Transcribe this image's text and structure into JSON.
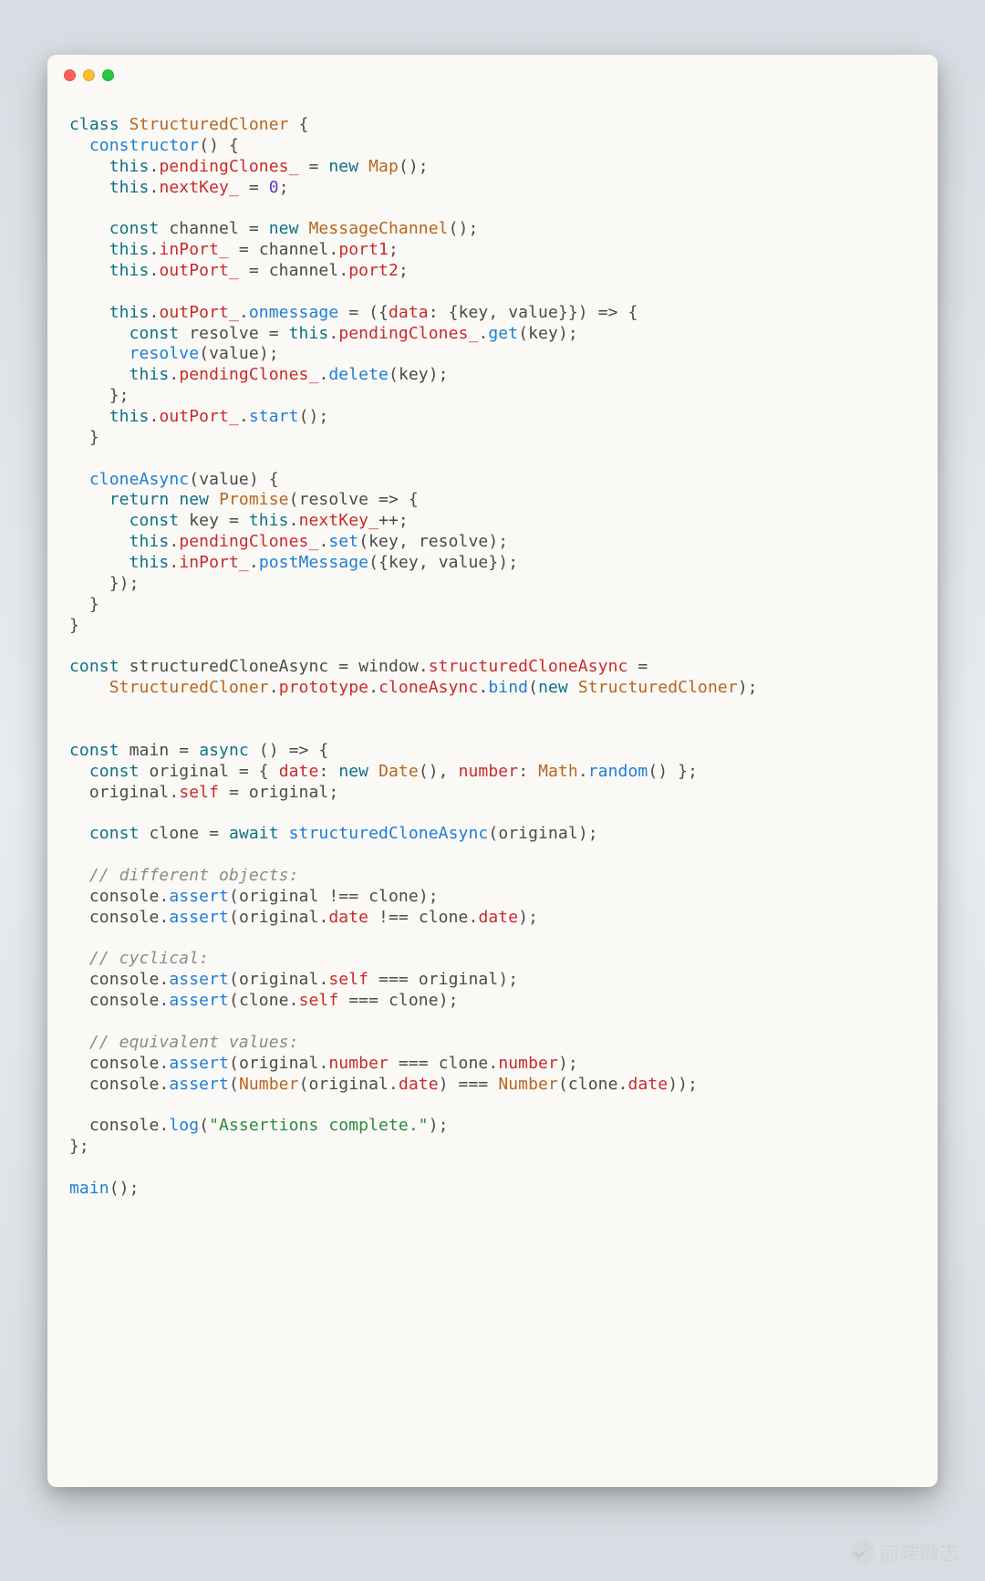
{
  "watermark": {
    "text": "前端微志"
  },
  "code": {
    "language": "javascript",
    "tokens": [
      {
        "t": "kw",
        "s": "class"
      },
      {
        "t": "punc",
        "s": " "
      },
      {
        "t": "cls",
        "s": "StructuredCloner"
      },
      {
        "t": "punc",
        "s": " {"
      },
      {
        "t": "nl"
      },
      {
        "t": "punc",
        "s": "  "
      },
      {
        "t": "fn",
        "s": "constructor"
      },
      {
        "t": "punc",
        "s": "() {"
      },
      {
        "t": "nl"
      },
      {
        "t": "punc",
        "s": "    "
      },
      {
        "t": "kw",
        "s": "this"
      },
      {
        "t": "punc",
        "s": "."
      },
      {
        "t": "prop",
        "s": "pendingClones_"
      },
      {
        "t": "punc",
        "s": " = "
      },
      {
        "t": "kw",
        "s": "new"
      },
      {
        "t": "punc",
        "s": " "
      },
      {
        "t": "cls",
        "s": "Map"
      },
      {
        "t": "punc",
        "s": "();"
      },
      {
        "t": "nl"
      },
      {
        "t": "punc",
        "s": "    "
      },
      {
        "t": "kw",
        "s": "this"
      },
      {
        "t": "punc",
        "s": "."
      },
      {
        "t": "prop",
        "s": "nextKey_"
      },
      {
        "t": "punc",
        "s": " = "
      },
      {
        "t": "num",
        "s": "0"
      },
      {
        "t": "punc",
        "s": ";"
      },
      {
        "t": "nl"
      },
      {
        "t": "nl"
      },
      {
        "t": "punc",
        "s": "    "
      },
      {
        "t": "kw",
        "s": "const"
      },
      {
        "t": "punc",
        "s": " "
      },
      {
        "t": "id",
        "s": "channel"
      },
      {
        "t": "punc",
        "s": " = "
      },
      {
        "t": "kw",
        "s": "new"
      },
      {
        "t": "punc",
        "s": " "
      },
      {
        "t": "cls",
        "s": "MessageChannel"
      },
      {
        "t": "punc",
        "s": "();"
      },
      {
        "t": "nl"
      },
      {
        "t": "punc",
        "s": "    "
      },
      {
        "t": "kw",
        "s": "this"
      },
      {
        "t": "punc",
        "s": "."
      },
      {
        "t": "prop",
        "s": "inPort_"
      },
      {
        "t": "punc",
        "s": " = "
      },
      {
        "t": "id",
        "s": "channel"
      },
      {
        "t": "punc",
        "s": "."
      },
      {
        "t": "prop",
        "s": "port1"
      },
      {
        "t": "punc",
        "s": ";"
      },
      {
        "t": "nl"
      },
      {
        "t": "punc",
        "s": "    "
      },
      {
        "t": "kw",
        "s": "this"
      },
      {
        "t": "punc",
        "s": "."
      },
      {
        "t": "prop",
        "s": "outPort_"
      },
      {
        "t": "punc",
        "s": " = "
      },
      {
        "t": "id",
        "s": "channel"
      },
      {
        "t": "punc",
        "s": "."
      },
      {
        "t": "prop",
        "s": "port2"
      },
      {
        "t": "punc",
        "s": ";"
      },
      {
        "t": "nl"
      },
      {
        "t": "nl"
      },
      {
        "t": "punc",
        "s": "    "
      },
      {
        "t": "kw",
        "s": "this"
      },
      {
        "t": "punc",
        "s": "."
      },
      {
        "t": "prop",
        "s": "outPort_"
      },
      {
        "t": "punc",
        "s": "."
      },
      {
        "t": "fn",
        "s": "onmessage"
      },
      {
        "t": "punc",
        "s": " = ({"
      },
      {
        "t": "prop",
        "s": "data"
      },
      {
        "t": "punc",
        "s": ": {"
      },
      {
        "t": "id",
        "s": "key"
      },
      {
        "t": "punc",
        "s": ", "
      },
      {
        "t": "id",
        "s": "value"
      },
      {
        "t": "punc",
        "s": "}}) => {"
      },
      {
        "t": "nl"
      },
      {
        "t": "punc",
        "s": "      "
      },
      {
        "t": "kw",
        "s": "const"
      },
      {
        "t": "punc",
        "s": " "
      },
      {
        "t": "id",
        "s": "resolve"
      },
      {
        "t": "punc",
        "s": " = "
      },
      {
        "t": "kw",
        "s": "this"
      },
      {
        "t": "punc",
        "s": "."
      },
      {
        "t": "prop",
        "s": "pendingClones_"
      },
      {
        "t": "punc",
        "s": "."
      },
      {
        "t": "fn",
        "s": "get"
      },
      {
        "t": "punc",
        "s": "("
      },
      {
        "t": "id",
        "s": "key"
      },
      {
        "t": "punc",
        "s": ");"
      },
      {
        "t": "nl"
      },
      {
        "t": "punc",
        "s": "      "
      },
      {
        "t": "fn",
        "s": "resolve"
      },
      {
        "t": "punc",
        "s": "("
      },
      {
        "t": "id",
        "s": "value"
      },
      {
        "t": "punc",
        "s": ");"
      },
      {
        "t": "nl"
      },
      {
        "t": "punc",
        "s": "      "
      },
      {
        "t": "kw",
        "s": "this"
      },
      {
        "t": "punc",
        "s": "."
      },
      {
        "t": "prop",
        "s": "pendingClones_"
      },
      {
        "t": "punc",
        "s": "."
      },
      {
        "t": "fn",
        "s": "delete"
      },
      {
        "t": "punc",
        "s": "("
      },
      {
        "t": "id",
        "s": "key"
      },
      {
        "t": "punc",
        "s": ");"
      },
      {
        "t": "nl"
      },
      {
        "t": "punc",
        "s": "    };"
      },
      {
        "t": "nl"
      },
      {
        "t": "punc",
        "s": "    "
      },
      {
        "t": "kw",
        "s": "this"
      },
      {
        "t": "punc",
        "s": "."
      },
      {
        "t": "prop",
        "s": "outPort_"
      },
      {
        "t": "punc",
        "s": "."
      },
      {
        "t": "fn",
        "s": "start"
      },
      {
        "t": "punc",
        "s": "();"
      },
      {
        "t": "nl"
      },
      {
        "t": "punc",
        "s": "  }"
      },
      {
        "t": "nl"
      },
      {
        "t": "nl"
      },
      {
        "t": "punc",
        "s": "  "
      },
      {
        "t": "fn",
        "s": "cloneAsync"
      },
      {
        "t": "punc",
        "s": "("
      },
      {
        "t": "id",
        "s": "value"
      },
      {
        "t": "punc",
        "s": ") {"
      },
      {
        "t": "nl"
      },
      {
        "t": "punc",
        "s": "    "
      },
      {
        "t": "kw",
        "s": "return"
      },
      {
        "t": "punc",
        "s": " "
      },
      {
        "t": "kw",
        "s": "new"
      },
      {
        "t": "punc",
        "s": " "
      },
      {
        "t": "cls",
        "s": "Promise"
      },
      {
        "t": "punc",
        "s": "("
      },
      {
        "t": "id",
        "s": "resolve"
      },
      {
        "t": "punc",
        "s": " => {"
      },
      {
        "t": "nl"
      },
      {
        "t": "punc",
        "s": "      "
      },
      {
        "t": "kw",
        "s": "const"
      },
      {
        "t": "punc",
        "s": " "
      },
      {
        "t": "id",
        "s": "key"
      },
      {
        "t": "punc",
        "s": " = "
      },
      {
        "t": "kw",
        "s": "this"
      },
      {
        "t": "punc",
        "s": "."
      },
      {
        "t": "prop",
        "s": "nextKey_"
      },
      {
        "t": "punc",
        "s": "++;"
      },
      {
        "t": "nl"
      },
      {
        "t": "punc",
        "s": "      "
      },
      {
        "t": "kw",
        "s": "this"
      },
      {
        "t": "punc",
        "s": "."
      },
      {
        "t": "prop",
        "s": "pendingClones_"
      },
      {
        "t": "punc",
        "s": "."
      },
      {
        "t": "fn",
        "s": "set"
      },
      {
        "t": "punc",
        "s": "("
      },
      {
        "t": "id",
        "s": "key"
      },
      {
        "t": "punc",
        "s": ", "
      },
      {
        "t": "id",
        "s": "resolve"
      },
      {
        "t": "punc",
        "s": ");"
      },
      {
        "t": "nl"
      },
      {
        "t": "punc",
        "s": "      "
      },
      {
        "t": "kw",
        "s": "this"
      },
      {
        "t": "punc",
        "s": "."
      },
      {
        "t": "prop",
        "s": "inPort_"
      },
      {
        "t": "punc",
        "s": "."
      },
      {
        "t": "fn",
        "s": "postMessage"
      },
      {
        "t": "punc",
        "s": "({"
      },
      {
        "t": "id",
        "s": "key"
      },
      {
        "t": "punc",
        "s": ", "
      },
      {
        "t": "id",
        "s": "value"
      },
      {
        "t": "punc",
        "s": "});"
      },
      {
        "t": "nl"
      },
      {
        "t": "punc",
        "s": "    });"
      },
      {
        "t": "nl"
      },
      {
        "t": "punc",
        "s": "  }"
      },
      {
        "t": "nl"
      },
      {
        "t": "punc",
        "s": "}"
      },
      {
        "t": "nl"
      },
      {
        "t": "nl"
      },
      {
        "t": "kw",
        "s": "const"
      },
      {
        "t": "punc",
        "s": " "
      },
      {
        "t": "id",
        "s": "structuredCloneAsync"
      },
      {
        "t": "punc",
        "s": " = "
      },
      {
        "t": "id",
        "s": "window"
      },
      {
        "t": "punc",
        "s": "."
      },
      {
        "t": "prop",
        "s": "structuredCloneAsync"
      },
      {
        "t": "punc",
        "s": " ="
      },
      {
        "t": "nl"
      },
      {
        "t": "punc",
        "s": "    "
      },
      {
        "t": "cls",
        "s": "StructuredCloner"
      },
      {
        "t": "punc",
        "s": "."
      },
      {
        "t": "prop",
        "s": "prototype"
      },
      {
        "t": "punc",
        "s": "."
      },
      {
        "t": "prop",
        "s": "cloneAsync"
      },
      {
        "t": "punc",
        "s": "."
      },
      {
        "t": "fn",
        "s": "bind"
      },
      {
        "t": "punc",
        "s": "("
      },
      {
        "t": "kw",
        "s": "new"
      },
      {
        "t": "punc",
        "s": " "
      },
      {
        "t": "cls",
        "s": "StructuredCloner"
      },
      {
        "t": "punc",
        "s": ");"
      },
      {
        "t": "nl"
      },
      {
        "t": "nl"
      },
      {
        "t": "nl"
      },
      {
        "t": "kw",
        "s": "const"
      },
      {
        "t": "punc",
        "s": " "
      },
      {
        "t": "id",
        "s": "main"
      },
      {
        "t": "punc",
        "s": " = "
      },
      {
        "t": "kw",
        "s": "async"
      },
      {
        "t": "punc",
        "s": " () => {"
      },
      {
        "t": "nl"
      },
      {
        "t": "punc",
        "s": "  "
      },
      {
        "t": "kw",
        "s": "const"
      },
      {
        "t": "punc",
        "s": " "
      },
      {
        "t": "id",
        "s": "original"
      },
      {
        "t": "punc",
        "s": " = { "
      },
      {
        "t": "prop",
        "s": "date"
      },
      {
        "t": "punc",
        "s": ": "
      },
      {
        "t": "kw",
        "s": "new"
      },
      {
        "t": "punc",
        "s": " "
      },
      {
        "t": "cls",
        "s": "Date"
      },
      {
        "t": "punc",
        "s": "(), "
      },
      {
        "t": "prop",
        "s": "number"
      },
      {
        "t": "punc",
        "s": ": "
      },
      {
        "t": "cls",
        "s": "Math"
      },
      {
        "t": "punc",
        "s": "."
      },
      {
        "t": "fn",
        "s": "random"
      },
      {
        "t": "punc",
        "s": "() };"
      },
      {
        "t": "nl"
      },
      {
        "t": "punc",
        "s": "  "
      },
      {
        "t": "id",
        "s": "original"
      },
      {
        "t": "punc",
        "s": "."
      },
      {
        "t": "prop",
        "s": "self"
      },
      {
        "t": "punc",
        "s": " = "
      },
      {
        "t": "id",
        "s": "original"
      },
      {
        "t": "punc",
        "s": ";"
      },
      {
        "t": "nl"
      },
      {
        "t": "nl"
      },
      {
        "t": "punc",
        "s": "  "
      },
      {
        "t": "kw",
        "s": "const"
      },
      {
        "t": "punc",
        "s": " "
      },
      {
        "t": "id",
        "s": "clone"
      },
      {
        "t": "punc",
        "s": " = "
      },
      {
        "t": "kw",
        "s": "await"
      },
      {
        "t": "punc",
        "s": " "
      },
      {
        "t": "fn",
        "s": "structuredCloneAsync"
      },
      {
        "t": "punc",
        "s": "("
      },
      {
        "t": "id",
        "s": "original"
      },
      {
        "t": "punc",
        "s": ");"
      },
      {
        "t": "nl"
      },
      {
        "t": "nl"
      },
      {
        "t": "punc",
        "s": "  "
      },
      {
        "t": "cmt",
        "s": "// different objects:"
      },
      {
        "t": "nl"
      },
      {
        "t": "punc",
        "s": "  "
      },
      {
        "t": "id",
        "s": "console"
      },
      {
        "t": "punc",
        "s": "."
      },
      {
        "t": "fn",
        "s": "assert"
      },
      {
        "t": "punc",
        "s": "("
      },
      {
        "t": "id",
        "s": "original"
      },
      {
        "t": "punc",
        "s": " !== "
      },
      {
        "t": "id",
        "s": "clone"
      },
      {
        "t": "punc",
        "s": ");"
      },
      {
        "t": "nl"
      },
      {
        "t": "punc",
        "s": "  "
      },
      {
        "t": "id",
        "s": "console"
      },
      {
        "t": "punc",
        "s": "."
      },
      {
        "t": "fn",
        "s": "assert"
      },
      {
        "t": "punc",
        "s": "("
      },
      {
        "t": "id",
        "s": "original"
      },
      {
        "t": "punc",
        "s": "."
      },
      {
        "t": "prop",
        "s": "date"
      },
      {
        "t": "punc",
        "s": " !== "
      },
      {
        "t": "id",
        "s": "clone"
      },
      {
        "t": "punc",
        "s": "."
      },
      {
        "t": "prop",
        "s": "date"
      },
      {
        "t": "punc",
        "s": ");"
      },
      {
        "t": "nl"
      },
      {
        "t": "nl"
      },
      {
        "t": "punc",
        "s": "  "
      },
      {
        "t": "cmt",
        "s": "// cyclical:"
      },
      {
        "t": "nl"
      },
      {
        "t": "punc",
        "s": "  "
      },
      {
        "t": "id",
        "s": "console"
      },
      {
        "t": "punc",
        "s": "."
      },
      {
        "t": "fn",
        "s": "assert"
      },
      {
        "t": "punc",
        "s": "("
      },
      {
        "t": "id",
        "s": "original"
      },
      {
        "t": "punc",
        "s": "."
      },
      {
        "t": "prop",
        "s": "self"
      },
      {
        "t": "punc",
        "s": " === "
      },
      {
        "t": "id",
        "s": "original"
      },
      {
        "t": "punc",
        "s": ");"
      },
      {
        "t": "nl"
      },
      {
        "t": "punc",
        "s": "  "
      },
      {
        "t": "id",
        "s": "console"
      },
      {
        "t": "punc",
        "s": "."
      },
      {
        "t": "fn",
        "s": "assert"
      },
      {
        "t": "punc",
        "s": "("
      },
      {
        "t": "id",
        "s": "clone"
      },
      {
        "t": "punc",
        "s": "."
      },
      {
        "t": "prop",
        "s": "self"
      },
      {
        "t": "punc",
        "s": " === "
      },
      {
        "t": "id",
        "s": "clone"
      },
      {
        "t": "punc",
        "s": ");"
      },
      {
        "t": "nl"
      },
      {
        "t": "nl"
      },
      {
        "t": "punc",
        "s": "  "
      },
      {
        "t": "cmt",
        "s": "// equivalent values:"
      },
      {
        "t": "nl"
      },
      {
        "t": "punc",
        "s": "  "
      },
      {
        "t": "id",
        "s": "console"
      },
      {
        "t": "punc",
        "s": "."
      },
      {
        "t": "fn",
        "s": "assert"
      },
      {
        "t": "punc",
        "s": "("
      },
      {
        "t": "id",
        "s": "original"
      },
      {
        "t": "punc",
        "s": "."
      },
      {
        "t": "prop",
        "s": "number"
      },
      {
        "t": "punc",
        "s": " === "
      },
      {
        "t": "id",
        "s": "clone"
      },
      {
        "t": "punc",
        "s": "."
      },
      {
        "t": "prop",
        "s": "number"
      },
      {
        "t": "punc",
        "s": ");"
      },
      {
        "t": "nl"
      },
      {
        "t": "punc",
        "s": "  "
      },
      {
        "t": "id",
        "s": "console"
      },
      {
        "t": "punc",
        "s": "."
      },
      {
        "t": "fn",
        "s": "assert"
      },
      {
        "t": "punc",
        "s": "("
      },
      {
        "t": "cls",
        "s": "Number"
      },
      {
        "t": "punc",
        "s": "("
      },
      {
        "t": "id",
        "s": "original"
      },
      {
        "t": "punc",
        "s": "."
      },
      {
        "t": "prop",
        "s": "date"
      },
      {
        "t": "punc",
        "s": ") === "
      },
      {
        "t": "cls",
        "s": "Number"
      },
      {
        "t": "punc",
        "s": "("
      },
      {
        "t": "id",
        "s": "clone"
      },
      {
        "t": "punc",
        "s": "."
      },
      {
        "t": "prop",
        "s": "date"
      },
      {
        "t": "punc",
        "s": "));"
      },
      {
        "t": "nl"
      },
      {
        "t": "nl"
      },
      {
        "t": "punc",
        "s": "  "
      },
      {
        "t": "id",
        "s": "console"
      },
      {
        "t": "punc",
        "s": "."
      },
      {
        "t": "fn",
        "s": "log"
      },
      {
        "t": "punc",
        "s": "("
      },
      {
        "t": "str",
        "s": "\"Assertions complete.\""
      },
      {
        "t": "punc",
        "s": ");"
      },
      {
        "t": "nl"
      },
      {
        "t": "punc",
        "s": "};"
      },
      {
        "t": "nl"
      },
      {
        "t": "nl"
      },
      {
        "t": "fn",
        "s": "main"
      },
      {
        "t": "punc",
        "s": "();"
      }
    ]
  }
}
